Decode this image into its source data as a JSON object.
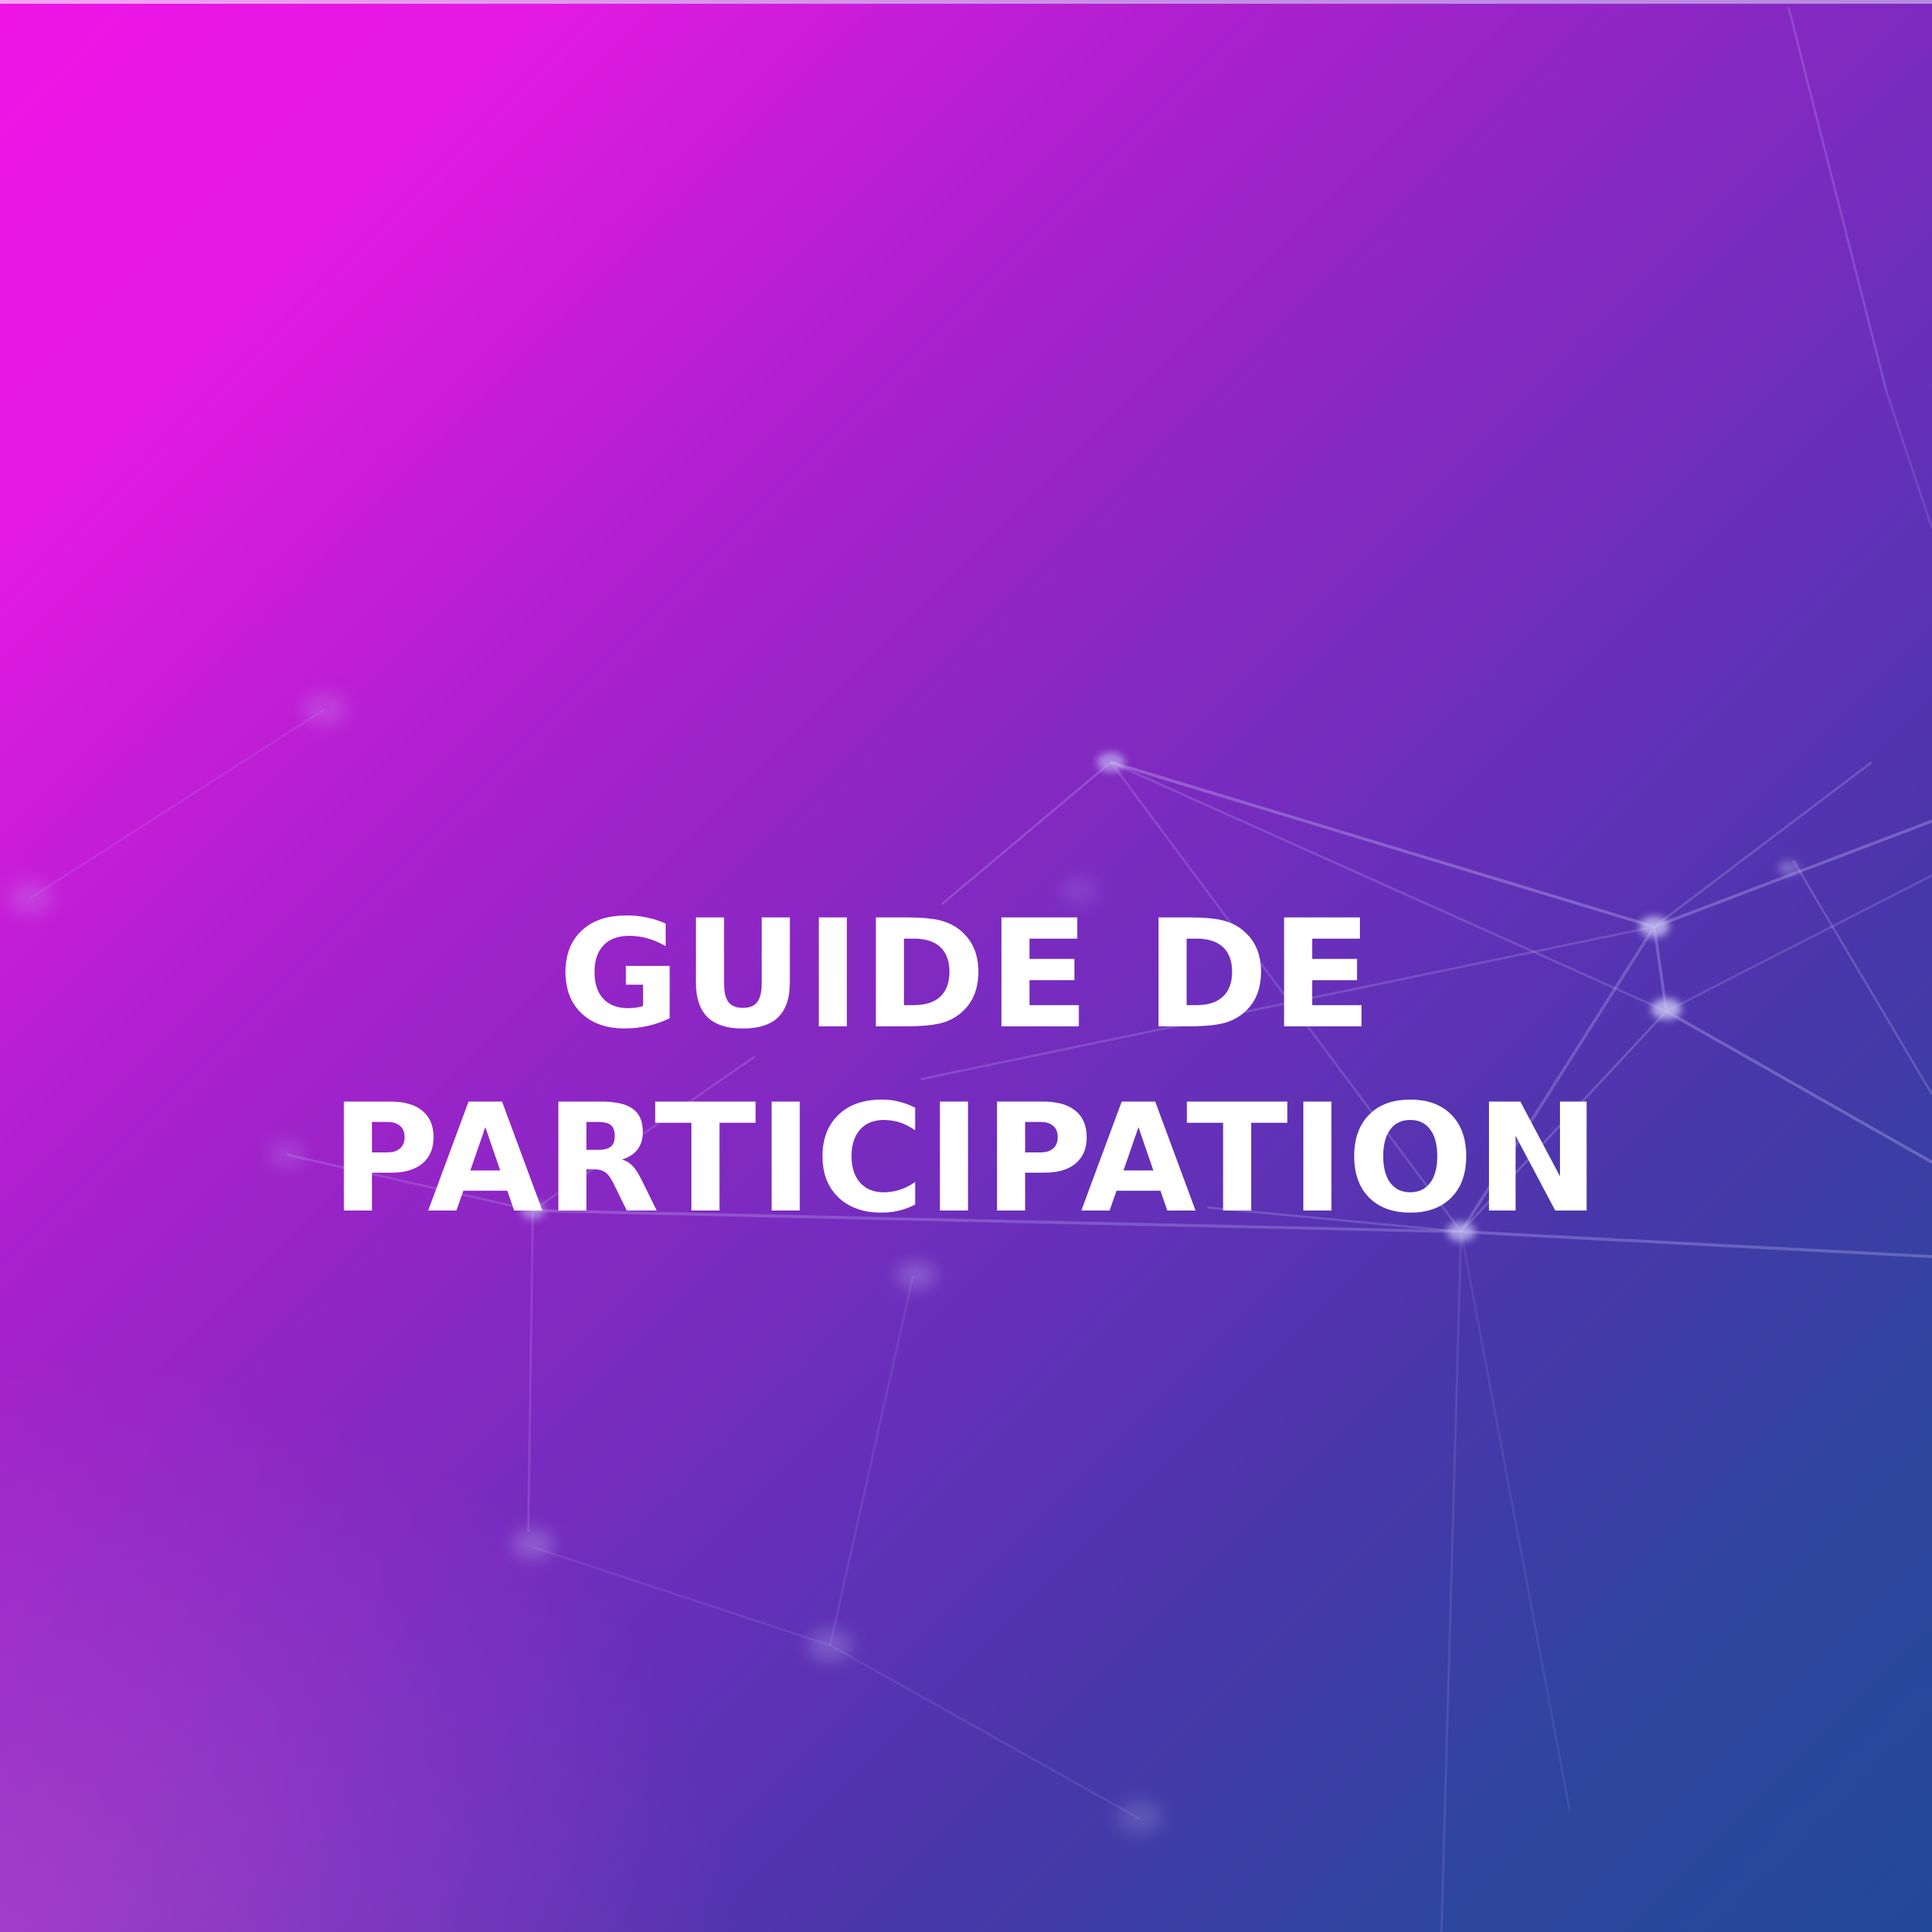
{
  "cover": {
    "title_line_1": "GUIDE DE",
    "title_line_2": "PARTICIPATION"
  },
  "colors": {
    "gradient_top_left": "#ee14e6",
    "gradient_middle": "#6a2fbb",
    "gradient_bottom_right": "#22489b",
    "title_text": "#ffffff",
    "network_lines": "#c6c0f4"
  }
}
